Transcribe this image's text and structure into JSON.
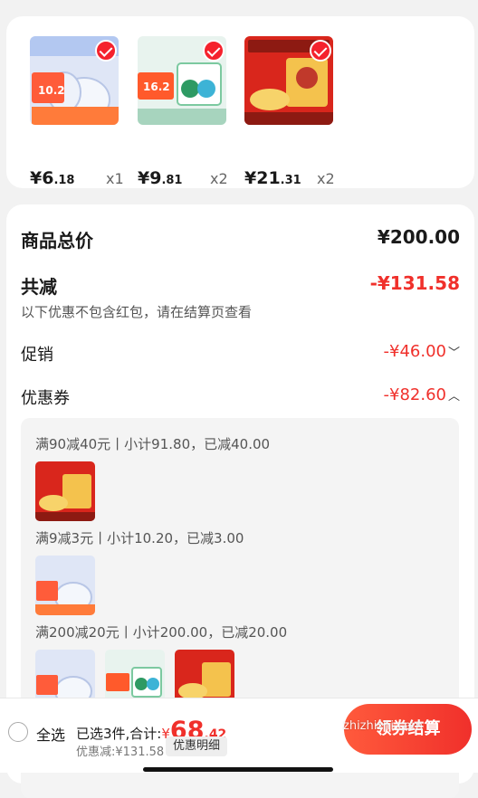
{
  "items": [
    {
      "price_int": "¥6",
      "price_dec": ".18",
      "qty": "x1",
      "icon": "bathroom-cleaner-product-image",
      "colors": [
        "#dfe6f6",
        "#ff5c3a",
        "#2f6fe4"
      ],
      "badge": "10.2"
    },
    {
      "price_int": "¥9",
      "price_dec": ".81",
      "qty": "x2",
      "icon": "laundry-pods-product-image",
      "colors": [
        "#e8f3ee",
        "#2e9a63",
        "#ff5a2b"
      ],
      "badge": "16.2"
    },
    {
      "price_int": "¥21",
      "price_dec": ".31",
      "qty": "x2",
      "icon": "snack-gift-box-product-image",
      "colors": [
        "#d9261c",
        "#f4c24d",
        "#8d1a12"
      ],
      "badge": ""
    }
  ],
  "summary": {
    "total_label": "商品总价",
    "total_value": "¥200.00",
    "reduce_label": "共减",
    "reduce_value": "-¥131.58",
    "note": "以下优惠不包含红包，请在结算页查看",
    "promo_label": "促销",
    "promo_value": "-¥46.00",
    "coupon_label": "优惠券",
    "coupon_value": "-¥82.60"
  },
  "coupons": [
    {
      "text": "满90减40元丨小计91.80，已减40.00"
    },
    {
      "text": "满9减3元丨小计10.20，已减3.00"
    },
    {
      "text": "满200减20元丨小计200.00，已减20.00"
    }
  ],
  "bottom": {
    "select_all": "全选",
    "selected_text": "已选3件,合计:",
    "total_yen": "¥",
    "total_int": "68",
    "total_dec": ".42",
    "discount_text": "优惠减:¥131.58",
    "discount_detail": "优惠明细",
    "checkout": "领券结算",
    "watermark": "zhizhizhi.com"
  }
}
